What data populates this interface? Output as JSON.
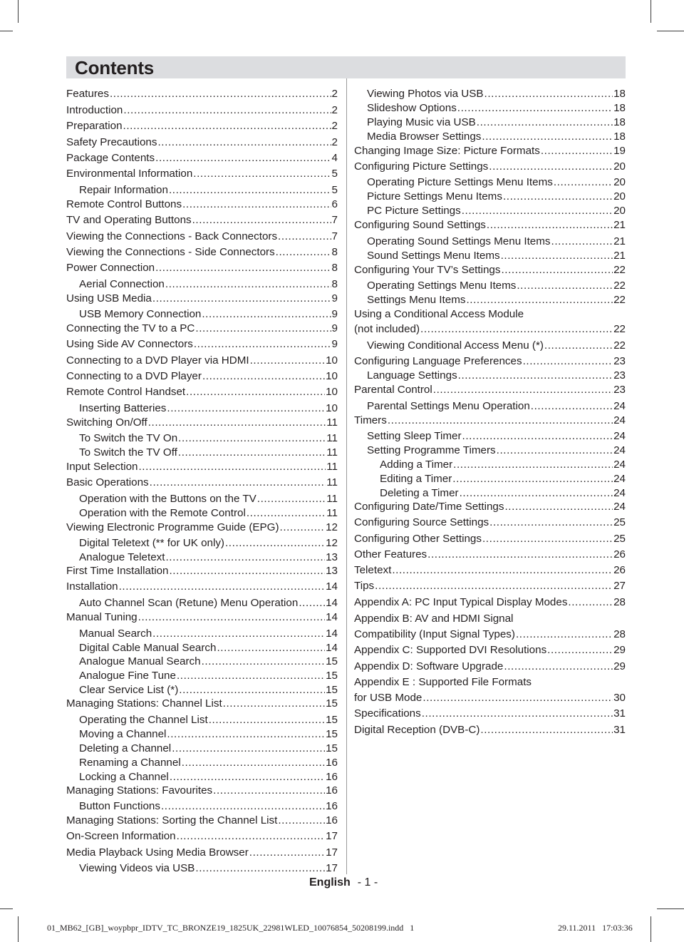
{
  "header": {
    "title": "Contents"
  },
  "toc": {
    "left": [
      {
        "title": "Features",
        "page": "2",
        "level": 0
      },
      {
        "title": "Introduction",
        "page": "2",
        "level": 0
      },
      {
        "title": "Preparation",
        "page": "2",
        "level": 0
      },
      {
        "title": "Safety Precautions",
        "page": "2",
        "level": 0
      },
      {
        "title": "Package Contents",
        "page": "4",
        "level": 0
      },
      {
        "title": "Environmental Information",
        "page": "5",
        "level": 0
      },
      {
        "title": "Repair Information",
        "page": "5",
        "level": 1
      },
      {
        "title": "Remote Control Buttons",
        "page": "6",
        "level": 0
      },
      {
        "title": "TV and Operating Buttons",
        "page": "7",
        "level": 0
      },
      {
        "title": "Viewing the Connections - Back Connectors",
        "page": "7",
        "level": 0
      },
      {
        "title": "Viewing the Connections - Side Connectors",
        "page": "8",
        "level": 0
      },
      {
        "title": "Power Connection",
        "page": "8",
        "level": 0
      },
      {
        "title": "Aerial Connection",
        "page": "8",
        "level": 1
      },
      {
        "title": "Using USB Media",
        "page": "9",
        "level": 0
      },
      {
        "title": "USB Memory Connection",
        "page": "9",
        "level": 1
      },
      {
        "title": "Connecting the TV to a PC",
        "page": "9",
        "level": 0
      },
      {
        "title": "Using Side AV Connectors",
        "page": "9",
        "level": 0
      },
      {
        "title": "Connecting to a DVD Player via HDMI",
        "page": "10",
        "level": 0
      },
      {
        "title": "Connecting to a DVD Player",
        "page": "10",
        "level": 0
      },
      {
        "title": "Remote Control Handset",
        "page": "10",
        "level": 0
      },
      {
        "title": "Inserting Batteries",
        "page": "10",
        "level": 1
      },
      {
        "title": "Switching On/Off",
        "page": "11",
        "level": 0
      },
      {
        "title": "To Switch the TV On",
        "page": "11",
        "level": 1
      },
      {
        "title": "To Switch the TV Off",
        "page": "11",
        "level": 1
      },
      {
        "title": "Input Selection",
        "page": "11",
        "level": 0
      },
      {
        "title": "Basic Operations",
        "page": "11",
        "level": 0
      },
      {
        "title": "Operation with the Buttons on the TV",
        "page": "11",
        "level": 1
      },
      {
        "title": "Operation with the Remote Control",
        "page": "11",
        "level": 1
      },
      {
        "title": "Viewing Electronic Programme Guide (EPG)",
        "page": "12",
        "level": 0
      },
      {
        "title": "Digital Teletext (** for UK only)",
        "page": "12",
        "level": 1
      },
      {
        "title": "Analogue Teletext",
        "page": "13",
        "level": 1
      },
      {
        "title": "First Time Installation",
        "page": "13",
        "level": 0
      },
      {
        "title": "Installation",
        "page": "14",
        "level": 0
      },
      {
        "title": "Auto Channel Scan (Retune) Menu Operation",
        "page": "14",
        "level": 1
      },
      {
        "title": "Manual Tuning",
        "page": "14",
        "level": 0
      },
      {
        "title": "Manual Search",
        "page": "14",
        "level": 1
      },
      {
        "title": "Digital Cable Manual Search",
        "page": "14",
        "level": 1
      },
      {
        "title": "Analogue Manual Search",
        "page": "15",
        "level": 1
      },
      {
        "title": "Analogue Fine Tune",
        "page": "15",
        "level": 1
      },
      {
        "title": "Clear Service List (*)",
        "page": "15",
        "level": 1
      },
      {
        "title": "Managing Stations: Channel List",
        "page": "15",
        "level": 0
      },
      {
        "title": "Operating the Channel List",
        "page": "15",
        "level": 1
      },
      {
        "title": "Moving a Channel",
        "page": "15",
        "level": 1
      },
      {
        "title": "Deleting a Channel",
        "page": "15",
        "level": 1
      },
      {
        "title": "Renaming a Channel",
        "page": "16",
        "level": 1
      },
      {
        "title": "Locking a Channel",
        "page": "16",
        "level": 1
      },
      {
        "title": "Managing Stations: Favourites",
        "page": "16",
        "level": 0
      },
      {
        "title": "Button Functions",
        "page": "16",
        "level": 1
      },
      {
        "title": "Managing Stations: Sorting the Channel List",
        "page": "16",
        "level": 0
      },
      {
        "title": "On-Screen Information",
        "page": "17",
        "level": 0
      },
      {
        "title": "Media Playback Using Media Browser",
        "page": "17",
        "level": 0
      },
      {
        "title": "Viewing Videos via USB",
        "page": "17",
        "level": 1
      }
    ],
    "right": [
      {
        "title": "Viewing Photos via USB",
        "page": "18",
        "level": 1
      },
      {
        "title": "Slideshow Options",
        "page": "18",
        "level": 1
      },
      {
        "title": "Playing Music via USB",
        "page": "18",
        "level": 1
      },
      {
        "title": "Media Browser Settings",
        "page": "18",
        "level": 1
      },
      {
        "title": "Changing Image Size: Picture Formats",
        "page": "19",
        "level": 0
      },
      {
        "title": "Configuring Picture Settings",
        "page": "20",
        "level": 0
      },
      {
        "title": "Operating Picture Settings Menu Items",
        "page": "20",
        "level": 1
      },
      {
        "title": "Picture Settings Menu Items",
        "page": "20",
        "level": 1
      },
      {
        "title": "PC Picture Settings",
        "page": "20",
        "level": 1
      },
      {
        "title": "Configuring Sound Settings",
        "page": "21",
        "level": 0
      },
      {
        "title": "Operating Sound Settings Menu Items",
        "page": "21",
        "level": 1
      },
      {
        "title": "Sound Settings Menu Items",
        "page": "21",
        "level": 1
      },
      {
        "title": "Configuring Your TV’s Settings",
        "page": "22",
        "level": 0
      },
      {
        "title": "Operating Settings Menu Items",
        "page": "22",
        "level": 1
      },
      {
        "title": "Settings Menu Items",
        "page": "22",
        "level": 1
      },
      {
        "title": "Using a Conditional Access Module",
        "page": "",
        "level": 0
      },
      {
        "title": "(not included)",
        "page": "22",
        "level": 0
      },
      {
        "title": "Viewing Conditional Access Menu (*)",
        "page": "22",
        "level": 1
      },
      {
        "title": "Configuring Language Preferences",
        "page": "23",
        "level": 0
      },
      {
        "title": "Language Settings",
        "page": "23",
        "level": 1
      },
      {
        "title": "Parental Control",
        "page": "23",
        "level": 0
      },
      {
        "title": "Parental Settings Menu Operation",
        "page": "24",
        "level": 1
      },
      {
        "title": "Timers",
        "page": "24",
        "level": 0
      },
      {
        "title": "Setting Sleep Timer",
        "page": "24",
        "level": 1
      },
      {
        "title": "Setting Programme Timers",
        "page": "24",
        "level": 1
      },
      {
        "title": "Adding a Timer",
        "page": "24",
        "level": 2
      },
      {
        "title": "Editing a Timer",
        "page": "24",
        "level": 2
      },
      {
        "title": "Deleting a Timer",
        "page": "24",
        "level": 2
      },
      {
        "title": "Configuring Date/Time Settings",
        "page": "24",
        "level": 0
      },
      {
        "title": "Configuring Source Settings",
        "page": "25",
        "level": 0
      },
      {
        "title": "Configuring Other Settings",
        "page": "25",
        "level": 0
      },
      {
        "title": "Other Features",
        "page": "26",
        "level": 0
      },
      {
        "title": "Teletext",
        "page": "26",
        "level": 0
      },
      {
        "title": "Tips",
        "page": "27",
        "level": 0
      },
      {
        "title": "Appendix A: PC Input Typical Display Modes",
        "page": "28",
        "level": 0
      },
      {
        "title": "Appendix B: AV and HDMI Signal",
        "page": "",
        "level": 0
      },
      {
        "title": "Compatibility (Input Signal Types)",
        "page": "28",
        "level": 0
      },
      {
        "title": "Appendix C: Supported DVI Resolutions",
        "page": "29",
        "level": 0
      },
      {
        "title": "Appendix D: Software Upgrade",
        "page": "29",
        "level": 0
      },
      {
        "title": "Appendix E : Supported File Formats",
        "page": "",
        "level": 0
      },
      {
        "title": "for USB Mode",
        "page": "30",
        "level": 0
      },
      {
        "title": "Specifications",
        "page": "31",
        "level": 0
      },
      {
        "title": "Digital Reception (DVB-C)",
        "page": "31",
        "level": 0
      }
    ]
  },
  "footer": {
    "language": "English",
    "page_number": "- 1 -",
    "slug_file": "01_MB62_[GB]_woypbpr_IDTV_TC_BRONZE19_1825UK_22981WLED_10076854_50208199.indd   1",
    "slug_timestamp": "29.11.2011   17:03:36"
  }
}
